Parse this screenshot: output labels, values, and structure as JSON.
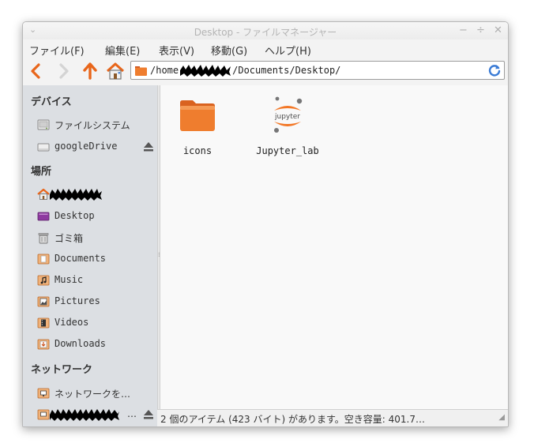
{
  "window": {
    "title": "Desktop - ファイルマネージャー",
    "menu_glyph": "⌄",
    "minimize_glyph": "−",
    "maximize_glyph": "÷",
    "close_glyph": "✕"
  },
  "menubar": [
    {
      "label": "ファイル(F)"
    },
    {
      "label": "編集(E)"
    },
    {
      "label": "表示(V)"
    },
    {
      "label": "移動(G)"
    },
    {
      "label": "ヘルプ(H)"
    }
  ],
  "toolbar": {
    "back_icon": "back-arrow-icon",
    "forward_icon": "forward-arrow-icon",
    "up_icon": "up-arrow-icon",
    "home_icon": "home-icon"
  },
  "location": {
    "prefix": "/home",
    "suffix": "/Documents/Desktop/"
  },
  "sidebar": {
    "sections": [
      {
        "heading": "デバイス"
      },
      {
        "heading": "場所"
      },
      {
        "heading": "ネットワーク"
      }
    ],
    "devices": [
      {
        "label": "ファイルシステム",
        "icon": "harddisk-icon"
      },
      {
        "label": "googleDrive",
        "icon": "drive-icon"
      }
    ],
    "places": [
      {
        "label": "",
        "icon": "home-icon"
      },
      {
        "label": "Desktop",
        "icon": "desktop-icon"
      },
      {
        "label": "ゴミ箱",
        "icon": "trash-icon"
      },
      {
        "label": "Documents",
        "icon": "documents-folder-icon"
      },
      {
        "label": "Music",
        "icon": "music-folder-icon"
      },
      {
        "label": "Pictures",
        "icon": "pictures-folder-icon"
      },
      {
        "label": "Videos",
        "icon": "videos-folder-icon"
      },
      {
        "label": "Downloads",
        "icon": "downloads-folder-icon"
      }
    ],
    "network": [
      {
        "label": "ネットワークを…",
        "icon": "network-folder-icon"
      },
      {
        "label": "…",
        "icon": "network-share-icon"
      }
    ]
  },
  "files": [
    {
      "name": "icons",
      "icon": "folder-icon"
    },
    {
      "name": "Jupyter_lab",
      "icon": "jupyter-icon",
      "logo_text": "jupyter"
    }
  ],
  "status": {
    "text": "2 個のアイテム (423 バイト) があります。空き容量: 401.7…"
  },
  "colors": {
    "accent_orange": "#e8661b",
    "sidebar_bg": "#dcdfe3",
    "content_bg": "#f9f9f9",
    "reload_blue": "#3a7bd5"
  }
}
